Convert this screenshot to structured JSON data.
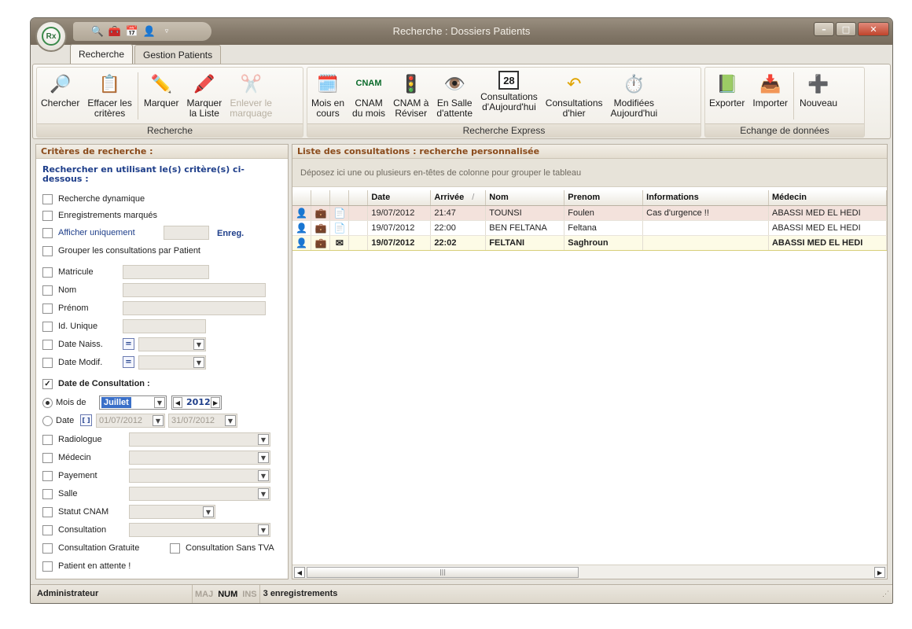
{
  "window": {
    "title": "Recherche : Dossiers Patients",
    "orb": "Rx",
    "minimize": "–",
    "maximize": "□",
    "close": "✕"
  },
  "tabs": [
    {
      "label": "Recherche"
    },
    {
      "label": "Gestion Patients"
    }
  ],
  "ribbon": {
    "groups": [
      {
        "name": "Recherche",
        "buttons": [
          {
            "l1": "Chercher",
            "l2": ""
          },
          {
            "l1": "Effacer les",
            "l2": "critères"
          },
          {
            "l1": "Marquer",
            "l2": ""
          },
          {
            "l1": "Marquer",
            "l2": "la Liste"
          },
          {
            "l1": "Enlever le",
            "l2": "marquage"
          }
        ]
      },
      {
        "name": "Recherche Express",
        "buttons": [
          {
            "l1": "Mois en",
            "l2": "cours"
          },
          {
            "l1": "CNAM",
            "l2": "du mois"
          },
          {
            "l1": "CNAM à",
            "l2": "Réviser"
          },
          {
            "l1": "En Salle",
            "l2": "d'attente"
          },
          {
            "l1": "Consultations",
            "l2": "d'Aujourd'hui"
          },
          {
            "l1": "Consultations",
            "l2": "d'hier"
          },
          {
            "l1": "Modifiées",
            "l2": "Aujourd'hui"
          }
        ]
      },
      {
        "name": "Echange de données",
        "buttons": [
          {
            "l1": "Exporter",
            "l2": ""
          },
          {
            "l1": "Importer",
            "l2": ""
          },
          {
            "l1": "Nouveau",
            "l2": ""
          }
        ]
      }
    ]
  },
  "criteria": {
    "header": "Critères de recherche :",
    "title": "Rechercher en utilisant le(s) critère(s) ci-dessous :",
    "dynamic": "Recherche dynamique",
    "marked": "Enregistrements marqués",
    "only": "Afficher uniquement",
    "enreg": "Enreg.",
    "group_by": "Grouper les consultations par Patient",
    "matricule": "Matricule",
    "nom": "Nom",
    "prenom": "Prénom",
    "id_unique": "Id. Unique",
    "date_naiss": "Date Naiss.",
    "date_modif": "Date Modif.",
    "eq": "=",
    "date_consult": "Date de Consultation :",
    "mois_de": "Mois de",
    "month": "Juillet",
    "year": "2012",
    "date": "Date",
    "date_from": "01/07/2012",
    "date_to": "31/07/2012",
    "radiologue": "Radiologue",
    "medecin": "Médecin",
    "payement": "Payement",
    "salle": "Salle",
    "statut_cnam": "Statut CNAM",
    "consultation": "Consultation",
    "gratuite": "Consultation Gratuite",
    "sans_tva": "Consultation Sans TVA",
    "attente": "Patient en attente !"
  },
  "list": {
    "header": "Liste des consultations : recherche personnalisée",
    "group_hint": "Déposez ici une ou plusieurs en-têtes de colonne pour grouper le tableau",
    "columns": [
      "Date",
      "Arrivée",
      "Nom",
      "Prenom",
      "Informations",
      "Médecin"
    ],
    "rows": [
      {
        "date": "19/07/2012",
        "arrivee": "21:47",
        "nom": "TOUNSI",
        "prenom": "Foulen",
        "info": "Cas d'urgence !!",
        "medecin": "ABASSI MED EL HEDI"
      },
      {
        "date": "19/07/2012",
        "arrivee": "22:00",
        "nom": "BEN FELTANA",
        "prenom": "Feltana",
        "info": "",
        "medecin": "ABASSI MED EL HEDI"
      },
      {
        "date": "19/07/2012",
        "arrivee": "22:02",
        "nom": "FELTANI",
        "prenom": "Saghroun",
        "info": "",
        "medecin": "ABASSI MED EL HEDI"
      }
    ]
  },
  "status": {
    "user": "Administrateur",
    "maj": "MAJ",
    "num": "NUM",
    "ins": "INS",
    "count": "3 enregistrements"
  }
}
